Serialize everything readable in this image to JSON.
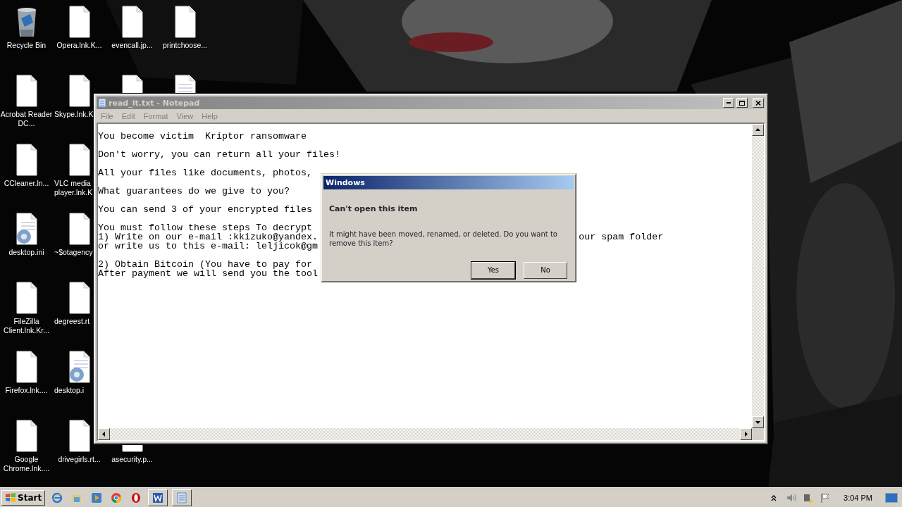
{
  "desktop_icons": [
    [
      {
        "label": "Recycle Bin",
        "kind": "recycle-bin"
      },
      {
        "label": "Opera.lnk.K...",
        "kind": "file"
      },
      {
        "label": "evencall.jp...",
        "kind": "file"
      },
      {
        "label": "printchoose...",
        "kind": "file"
      }
    ],
    [
      {
        "label": "Acrobat Reader DC...",
        "kind": "file"
      },
      {
        "label": "Skype.lnk.K",
        "kind": "file"
      },
      {
        "kind": "file"
      },
      {
        "kind": "text-file"
      }
    ],
    [
      {
        "label": "CCleaner.ln...",
        "kind": "file"
      },
      {
        "label": "VLC media player.lnk.K",
        "kind": "file"
      }
    ],
    [
      {
        "label": "desktop.ini",
        "kind": "settings-file"
      },
      {
        "label": "~$otagency",
        "kind": "file"
      }
    ],
    [
      {
        "label": "FileZilla Client.lnk.Kr...",
        "kind": "file"
      },
      {
        "label": "degreest.rt",
        "kind": "file"
      }
    ],
    [
      {
        "label": "Firefox.lnk....",
        "kind": "file"
      },
      {
        "label": "desktop.i",
        "kind": "settings-file"
      }
    ],
    [
      {
        "label": "Google Chrome.lnk....",
        "kind": "file"
      },
      {
        "label": "drivegirls.rt...",
        "kind": "file"
      },
      {
        "label": "asecurity.p...",
        "kind": "file"
      }
    ]
  ],
  "notepad": {
    "title": "read_it.txt - Notepad",
    "active": false,
    "menu": [
      "File",
      "Edit",
      "Format",
      "View",
      "Help"
    ],
    "paragraphs": [
      [
        {
          "text": "You become victim  Kriptor ransomware"
        }
      ],
      [
        {
          "text": "Don't worry, you can return all your files!"
        }
      ],
      [
        {
          "text": "All your files like documents, photos,"
        }
      ],
      [
        {
          "text": "What guarantees do we give to you?"
        }
      ],
      [
        {
          "text": "You can send 3 of your encrypted files"
        }
      ],
      [
        {
          "text": "You must follow these steps To decrypt"
        },
        {
          "text": "1) Write on our e-mail :kkizuko@yandex.",
          "right_text": "our spam folder"
        },
        {
          "text": "or write us to this e-mail: leljicok@gm"
        }
      ],
      [
        {
          "text": "2) Obtain Bitcoin (You have to pay for"
        },
        {
          "text": "After payment we will send you the tool"
        }
      ]
    ]
  },
  "dialog": {
    "title": "Windows",
    "heading": "Can't open this item",
    "message": "It might have been moved, renamed, or deleted. Do you want to remove this item?",
    "buttons": [
      {
        "label": "Yes",
        "default": true
      },
      {
        "label": "No",
        "default": false
      }
    ]
  },
  "taskbar": {
    "start": "Start",
    "clock": "3:04 PM"
  }
}
